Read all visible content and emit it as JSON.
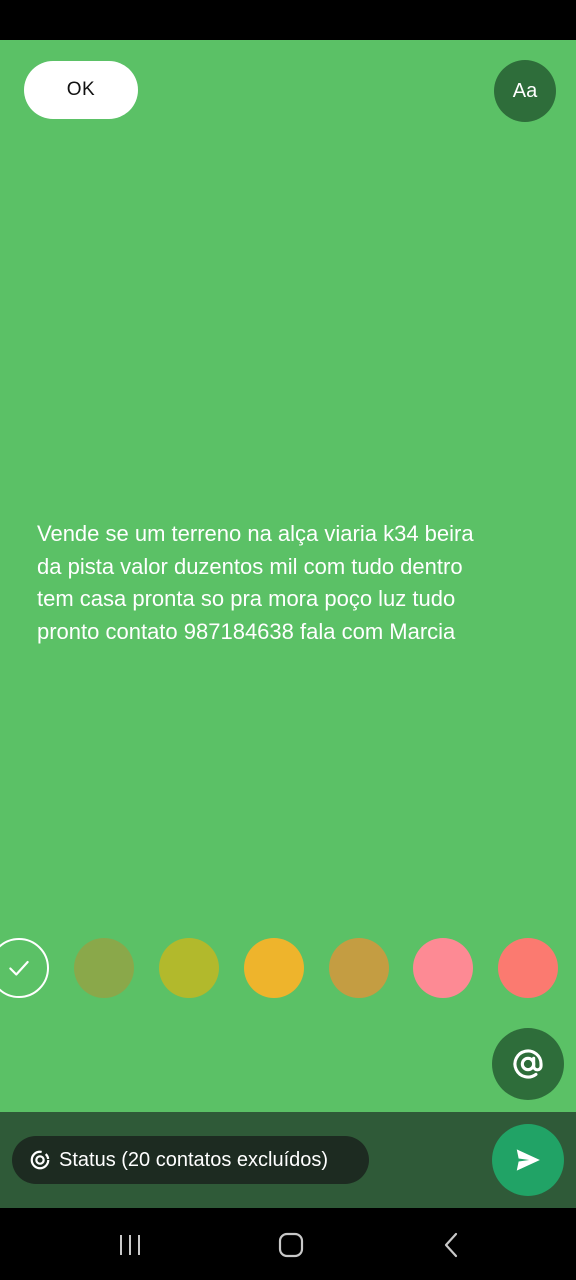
{
  "header": {
    "ok_label": "OK",
    "font_label": "Aa"
  },
  "status": {
    "text": "Vende se um terreno na alça viaria k34 beira\nda pista valor duzentos mil com tudo dentro\ntem casa pronta so pra mora poço luz tudo\npronto contato 987184638 fala com Marcia"
  },
  "colors": {
    "background": "#5bc166",
    "swatches": [
      "#8aa84a",
      "#b2b92c",
      "#eeb42c",
      "#c49d42",
      "#fd8a94",
      "#fb7a70"
    ]
  },
  "footer": {
    "audience_label": "Status (20 contatos excluídos)"
  },
  "icons": {
    "selected": "check-icon",
    "mention": "at-sign-icon",
    "send": "send-icon",
    "audience": "status-ring-icon",
    "nav": [
      "recent-apps-icon",
      "home-icon",
      "back-icon"
    ]
  }
}
